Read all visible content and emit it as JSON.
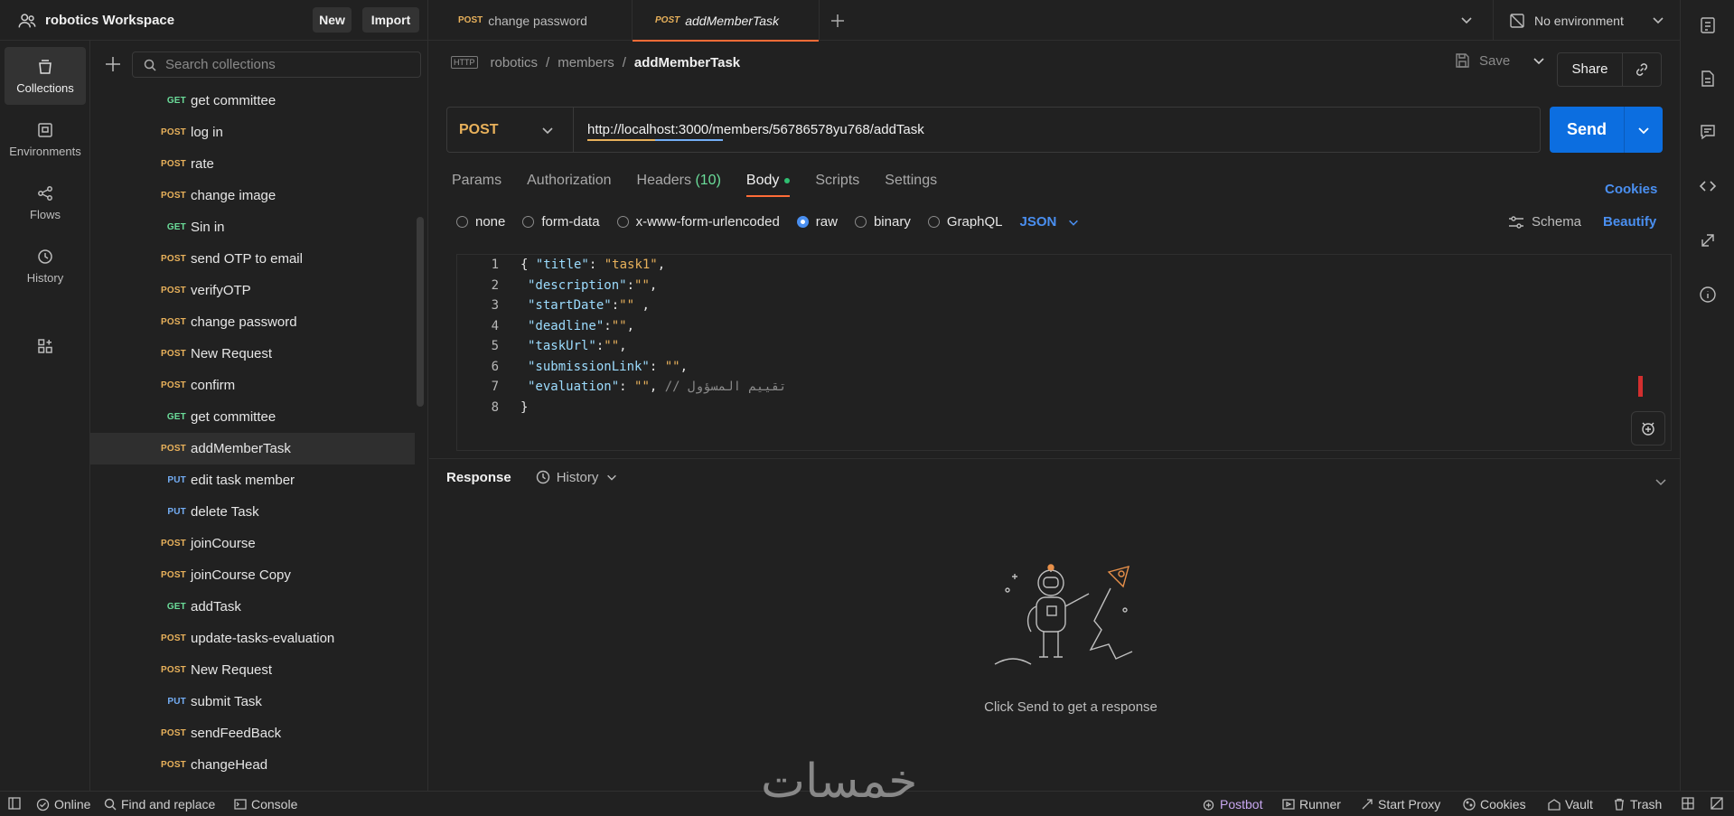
{
  "workspace": {
    "name": "robotics Workspace",
    "new_label": "New",
    "import_label": "Import"
  },
  "tabs": [
    {
      "method": "POST",
      "label": "change password"
    },
    {
      "method": "POST",
      "label": "addMemberTask"
    }
  ],
  "environment": {
    "label": "No environment"
  },
  "rail": {
    "collections": "Collections",
    "environments": "Environments",
    "flows": "Flows",
    "history": "History"
  },
  "sidebar": {
    "search_placeholder": "Search collections",
    "items": [
      {
        "method": "GET",
        "label": "get committee"
      },
      {
        "method": "POST",
        "label": "log in"
      },
      {
        "method": "POST",
        "label": "rate"
      },
      {
        "method": "POST",
        "label": "change image"
      },
      {
        "method": "GET",
        "label": "Sin in"
      },
      {
        "method": "POST",
        "label": "send OTP to email"
      },
      {
        "method": "POST",
        "label": "verifyOTP"
      },
      {
        "method": "POST",
        "label": "change password"
      },
      {
        "method": "POST",
        "label": "New Request"
      },
      {
        "method": "POST",
        "label": "confirm"
      },
      {
        "method": "GET",
        "label": "get committee"
      },
      {
        "method": "POST",
        "label": "addMemberTask"
      },
      {
        "method": "PUT",
        "label": "edit task member"
      },
      {
        "method": "PUT",
        "label": "delete Task"
      },
      {
        "method": "POST",
        "label": "joinCourse"
      },
      {
        "method": "POST",
        "label": "joinCourse Copy"
      },
      {
        "method": "GET",
        "label": "addTask"
      },
      {
        "method": "POST",
        "label": "update-tasks-evaluation"
      },
      {
        "method": "POST",
        "label": "New Request"
      },
      {
        "method": "PUT",
        "label": "submit Task"
      },
      {
        "method": "POST",
        "label": "sendFeedBack"
      },
      {
        "method": "POST",
        "label": "changeHead"
      }
    ]
  },
  "breadcrumb": {
    "http_badge": "HTTP",
    "part1": "robotics",
    "part2": "members",
    "current": "addMemberTask"
  },
  "toolbar": {
    "save_label": "Save",
    "share_label": "Share"
  },
  "request": {
    "method": "POST",
    "url": "http://localhost:3000/members/56786578yu768/addTask",
    "send_label": "Send"
  },
  "request_tabs": {
    "params": "Params",
    "authorization": "Authorization",
    "headers": "Headers",
    "headers_count": "(10)",
    "body": "Body",
    "scripts": "Scripts",
    "settings": "Settings",
    "cookies": "Cookies"
  },
  "body_options": {
    "none": "none",
    "form_data": "form-data",
    "urlencoded": "x-www-form-urlencoded",
    "raw": "raw",
    "binary": "binary",
    "graphql": "GraphQL",
    "format": "JSON",
    "schema": "Schema",
    "beautify": "Beautify"
  },
  "editor": {
    "line_numbers": [
      "1",
      "2",
      "3",
      "4",
      "5",
      "6",
      "7",
      "8"
    ],
    "l1_open": "{ ",
    "l1_key": "\"title\"",
    "l1_colon": ": ",
    "l1_val": "\"task1\"",
    "l1_end": ",",
    "l2_key": "\"description\"",
    "l2_rest": ":",
    "l2_val": "\"\"",
    "l2_end": ",",
    "l3_key": "\"startDate\"",
    "l3_rest": ":",
    "l3_val": "\"\"",
    "l3_end": " ,",
    "l4_key": "\"deadline\"",
    "l4_rest": ":",
    "l4_val": "\"\"",
    "l4_end": ",",
    "l5_key": "\"taskUrl\"",
    "l5_rest": ":",
    "l5_val": "\"\"",
    "l5_end": ",",
    "l6_key": "\"submissionLink\"",
    "l6_rest": ": ",
    "l6_val": "\"\"",
    "l6_end": ",",
    "l7_key": "\"evaluation\"",
    "l7_rest": ": ",
    "l7_val": "\"\"",
    "l7_end": ", ",
    "l7_comment": "// تقييم المسؤول",
    "l8": "}"
  },
  "response": {
    "title": "Response",
    "history": "History",
    "empty_message": "Click Send to get a response"
  },
  "statusbar": {
    "online": "Online",
    "find_replace": "Find and replace",
    "console": "Console",
    "postbot": "Postbot",
    "runner": "Runner",
    "start_proxy": "Start Proxy",
    "cookies": "Cookies",
    "vault": "Vault",
    "trash": "Trash"
  },
  "watermark": "خمسات",
  "colors": {
    "accent": "#ff6c37",
    "send": "#0c6ee0",
    "post": "#e8b15b",
    "get": "#6bdd9a",
    "put": "#74aef6",
    "link": "#4a8ff0"
  }
}
